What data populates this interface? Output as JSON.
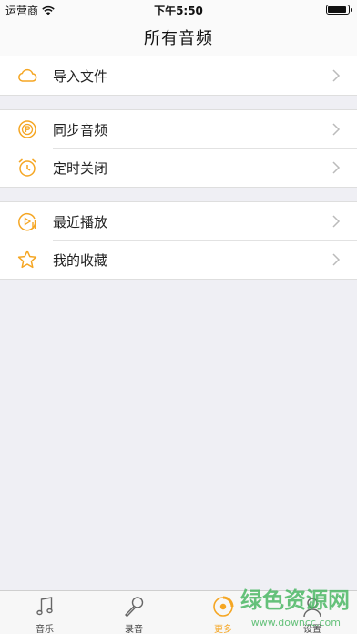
{
  "status_bar": {
    "carrier": "运营商",
    "time": "下午5:50",
    "wifi_icon": "wifi-icon",
    "battery_icon": "battery-icon"
  },
  "nav": {
    "title": "所有音频"
  },
  "accent_color": "#f5a623",
  "groups": [
    {
      "items": [
        {
          "label": "导入文件",
          "icon": "cloud-icon"
        }
      ]
    },
    {
      "items": [
        {
          "label": "同步音频",
          "icon": "sync-audio-icon"
        },
        {
          "label": "定时关闭",
          "icon": "alarm-clock-icon"
        }
      ]
    },
    {
      "items": [
        {
          "label": "最近播放",
          "icon": "recent-play-icon"
        },
        {
          "label": "我的收藏",
          "icon": "star-icon"
        }
      ]
    }
  ],
  "tabs": [
    {
      "label": "音乐",
      "icon": "music-note-icon",
      "active": false
    },
    {
      "label": "录音",
      "icon": "microphone-icon",
      "active": false
    },
    {
      "label": "更多",
      "icon": "more-icon",
      "active": true
    },
    {
      "label": "设置",
      "icon": "person-icon",
      "active": false
    }
  ],
  "watermark": {
    "title": "绿色资源网",
    "url": "www.downcc.com"
  }
}
